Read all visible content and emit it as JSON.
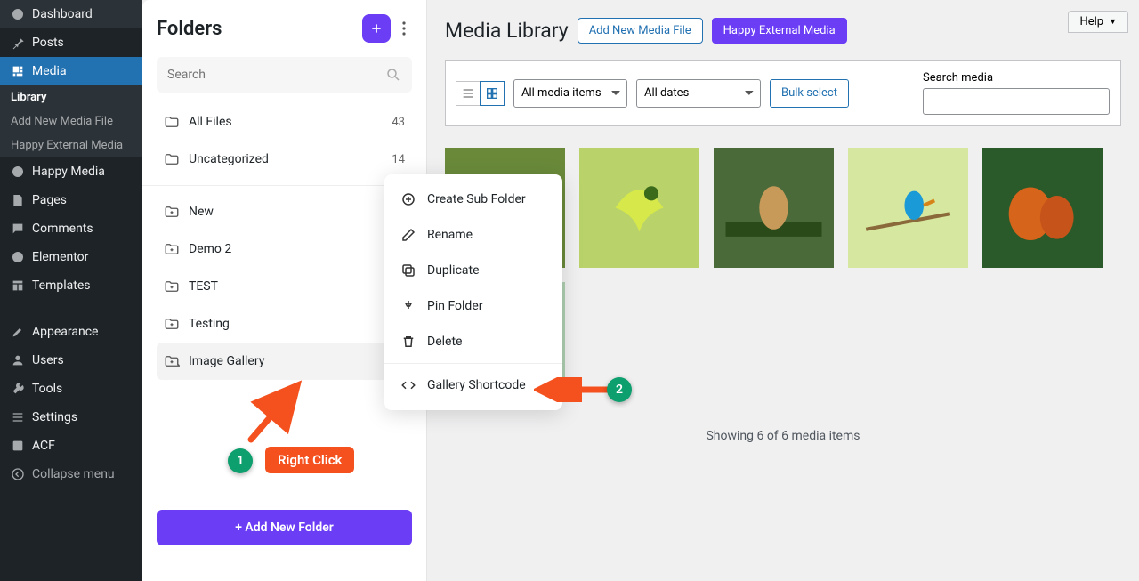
{
  "wp_sidebar": {
    "items": [
      {
        "label": "Dashboard"
      },
      {
        "label": "Posts"
      },
      {
        "label": "Media"
      },
      {
        "label": "Happy Media"
      },
      {
        "label": "Pages"
      },
      {
        "label": "Comments"
      },
      {
        "label": "Elementor"
      },
      {
        "label": "Templates"
      },
      {
        "label": "Appearance"
      },
      {
        "label": "Users"
      },
      {
        "label": "Tools"
      },
      {
        "label": "Settings"
      },
      {
        "label": "ACF"
      }
    ],
    "media_sub": [
      "Library",
      "Add New Media File",
      "Happy External Media"
    ],
    "collapse": "Collapse menu"
  },
  "folders_panel": {
    "title": "Folders",
    "search_placeholder": "Search",
    "pinned": [
      {
        "label": "All Files",
        "count": "43"
      },
      {
        "label": "Uncategorized",
        "count": "14"
      }
    ],
    "folders": [
      {
        "label": "New"
      },
      {
        "label": "Demo 2"
      },
      {
        "label": "TEST"
      },
      {
        "label": "Testing"
      },
      {
        "label": "Image Gallery"
      }
    ],
    "add_button": "+ Add New Folder"
  },
  "context_menu": {
    "create_sub": "Create Sub Folder",
    "rename": "Rename",
    "duplicate": "Duplicate",
    "pin": "Pin Folder",
    "delete": "Delete",
    "gallery_shortcode": "Gallery Shortcode"
  },
  "main": {
    "help": "Help",
    "title": "Media Library",
    "add_new_label": "Add New Media File",
    "happy_external": "Happy External Media",
    "filter_type": "All media items",
    "filter_date": "All dates",
    "bulk_select": "Bulk select",
    "search_label": "Search media",
    "status": "Showing 6 of 6 media items"
  },
  "annotations": {
    "b1": "1",
    "b2": "2",
    "right_click": "Right Click"
  }
}
